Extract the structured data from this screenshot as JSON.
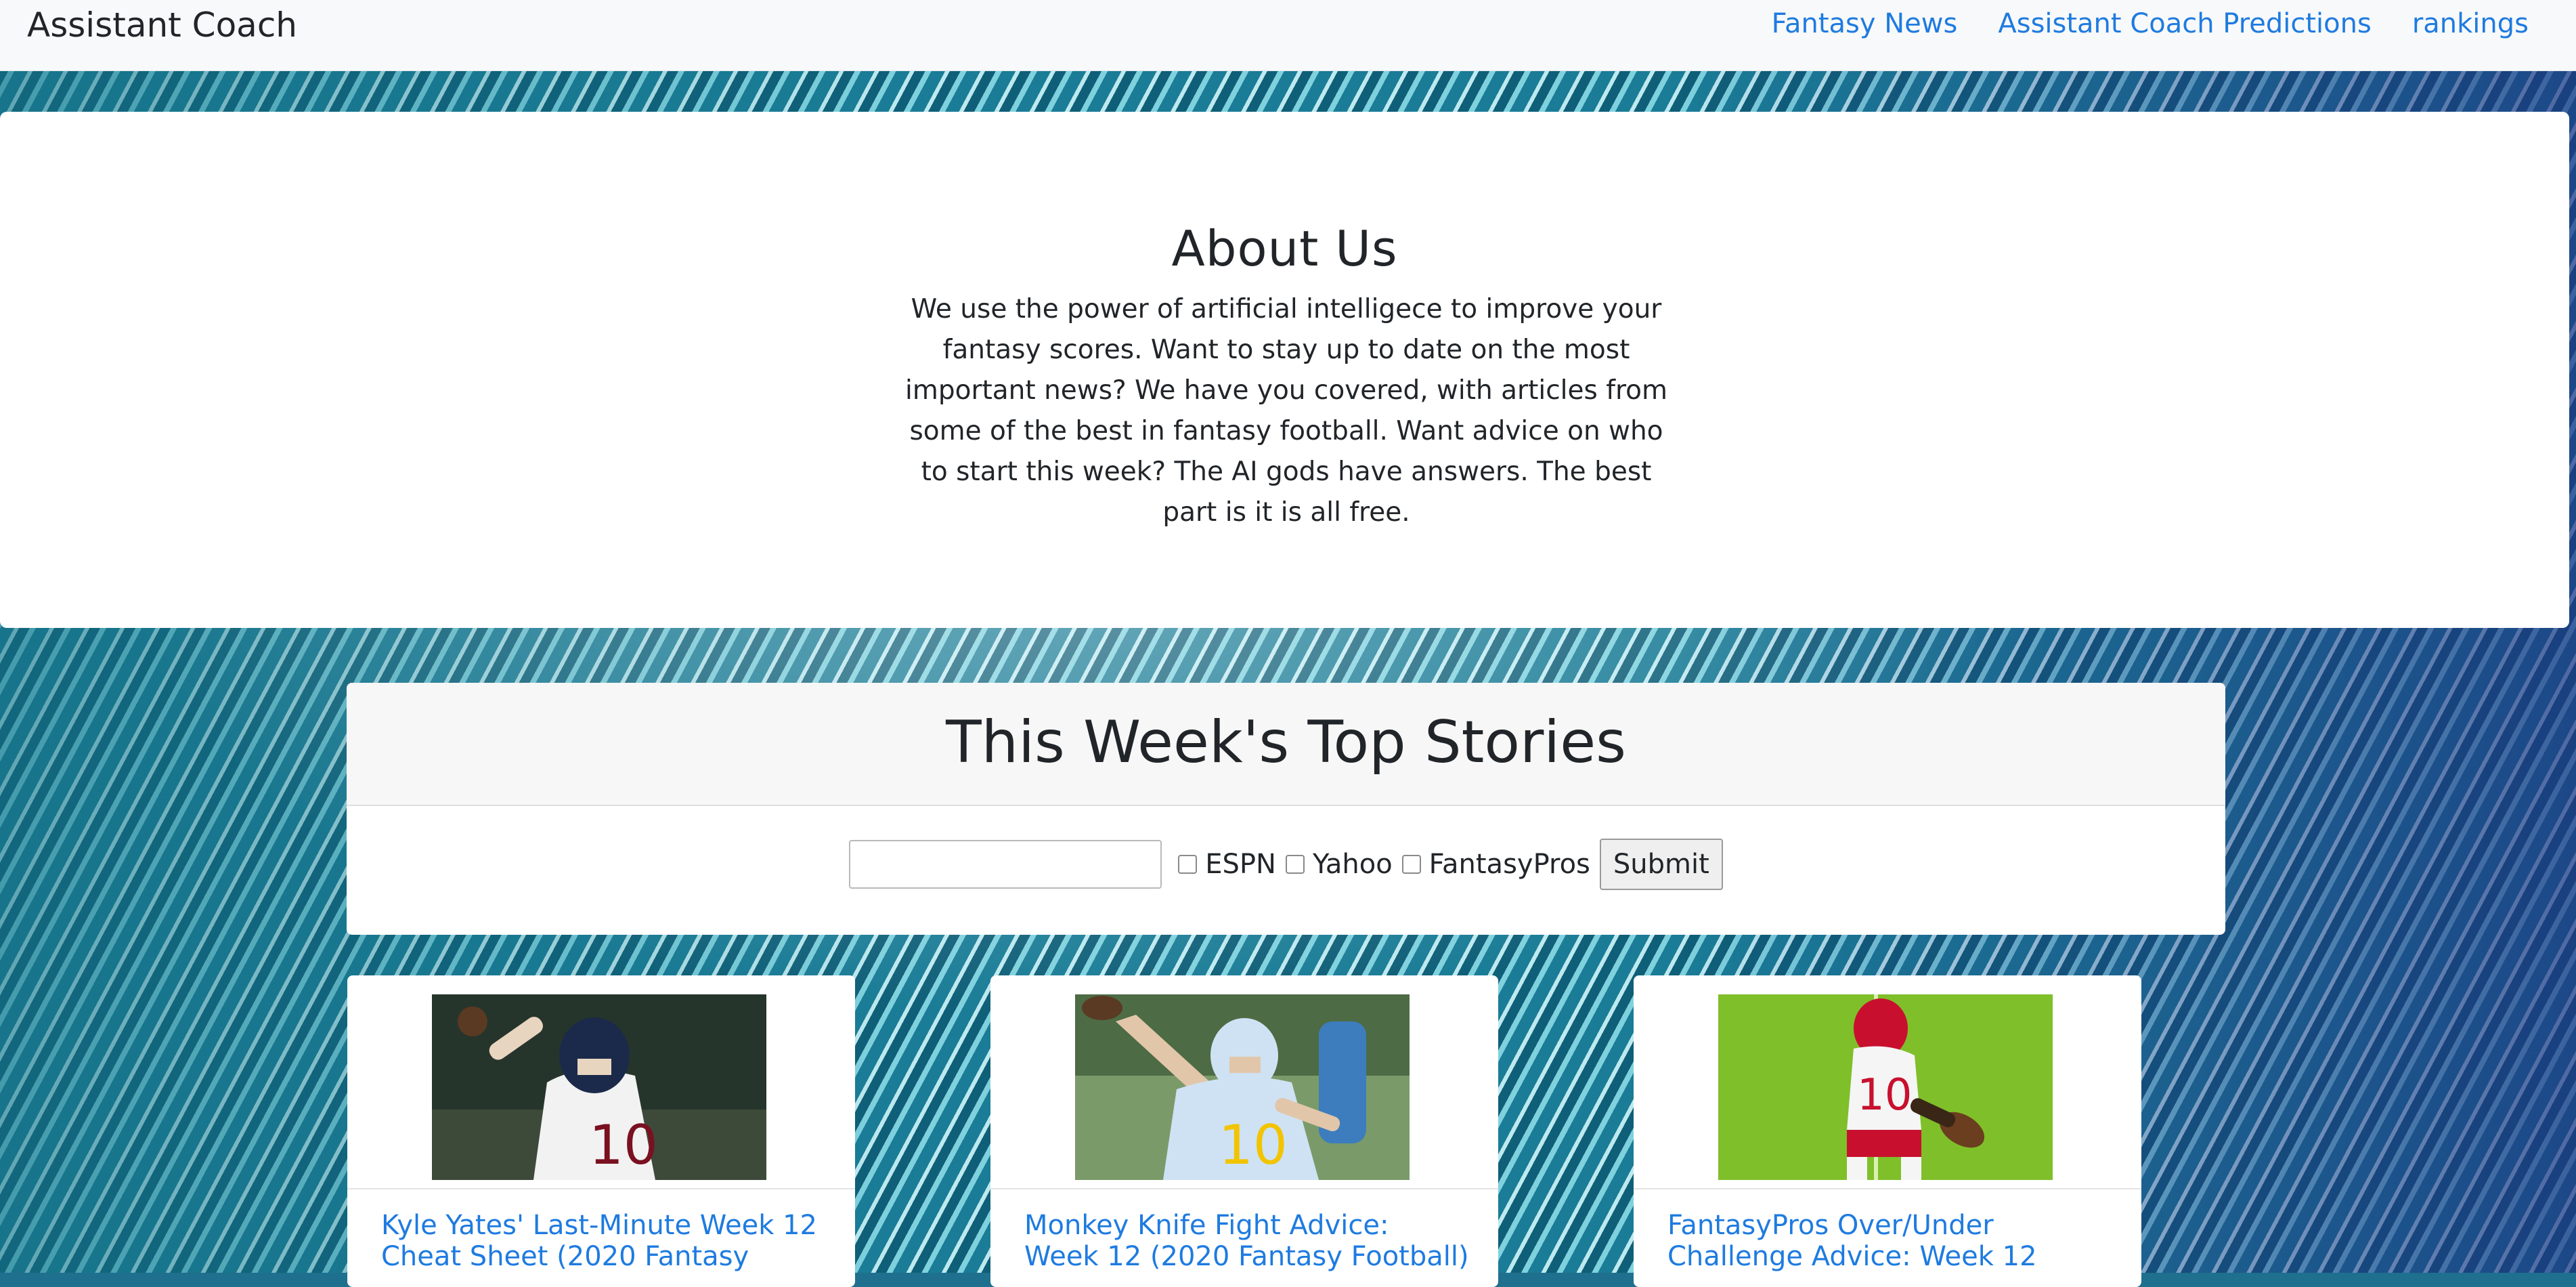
{
  "navbar": {
    "brand": "Assistant Coach",
    "links": [
      "Fantasy News",
      "Assistant Coach Predictions",
      "rankings"
    ]
  },
  "about": {
    "title": "About Us",
    "body": "We use the power of artificial intelligece to improve your fantasy scores. Want to stay up to date on the most important news? We have you covered, with articles from some of the best in fantasy football. Want advice on who to start this week? The AI gods have answers. The best part is it is all free."
  },
  "top_stories": {
    "title": "This Week's Top Stories",
    "search_value": "",
    "sources": [
      "ESPN",
      "Yahoo",
      "FantasyPros"
    ],
    "submit_label": "Submit"
  },
  "articles": [
    {
      "title": "Kyle Yates' Last-Minute Week 12 Cheat Sheet (2020 Fantasy",
      "jersey": "10",
      "colors": {
        "field": "#2b3a2f",
        "jersey": "#f2f2f2",
        "helmet": "#1b2a4a",
        "accent": "#c8102e"
      }
    },
    {
      "title": "Monkey Knife Fight Advice: Week 12 (2020 Fantasy Football)",
      "jersey": "10",
      "colors": {
        "field": "#6a8a5a",
        "jersey": "#cfe2f3",
        "helmet": "#cfe2f3",
        "accent": "#f2c400"
      }
    },
    {
      "title": "FantasyPros Over/Under Challenge Advice: Week 12",
      "jersey": "10",
      "colors": {
        "field": "#7fbf2a",
        "jersey": "#f5f5f5",
        "helmet": "#c8102e",
        "accent": "#c8102e"
      }
    }
  ]
}
